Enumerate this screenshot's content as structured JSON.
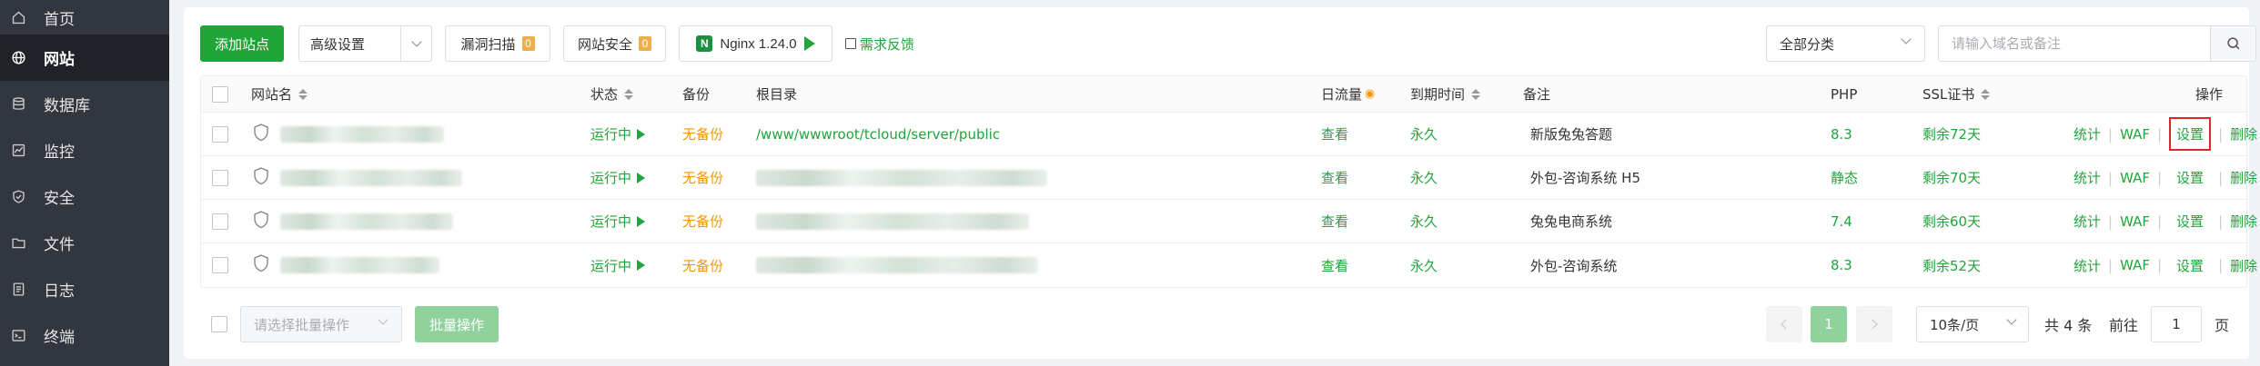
{
  "sidebar": {
    "items": [
      {
        "label": "首页",
        "icon": "home-icon"
      },
      {
        "label": "网站",
        "icon": "globe-icon",
        "active": true
      },
      {
        "label": "数据库",
        "icon": "database-icon"
      },
      {
        "label": "监控",
        "icon": "monitor-icon"
      },
      {
        "label": "安全",
        "icon": "shield-icon"
      },
      {
        "label": "文件",
        "icon": "folder-icon"
      },
      {
        "label": "日志",
        "icon": "log-icon"
      },
      {
        "label": "终端",
        "icon": "terminal-icon"
      }
    ]
  },
  "toolbar": {
    "add_site": "添加站点",
    "advanced": "高级设置",
    "vuln_scan": "漏洞扫描",
    "vuln_count": "0",
    "site_security": "网站安全",
    "security_count": "0",
    "nginx": "Nginx 1.24.0",
    "feedback": "需求反馈",
    "category": "全部分类",
    "search_placeholder": "请输入域名或备注"
  },
  "table": {
    "headers": {
      "name": "网站名",
      "status": "状态",
      "backup": "备份",
      "root": "根目录",
      "traffic": "日流量",
      "expire": "到期时间",
      "remark": "备注",
      "php": "PHP",
      "ssl": "SSL证书",
      "ops": "操作"
    },
    "rows": [
      {
        "status": "运行中",
        "backup": "无备份",
        "root": "/www/wwwroot/tcloud/server/public",
        "traffic": "查看",
        "expire": "永久",
        "remark": "新版兔兔答题",
        "php": "8.3",
        "ssl": "剩余72天"
      },
      {
        "status": "运行中",
        "backup": "无备份",
        "root": "",
        "traffic": "查看",
        "expire": "永久",
        "remark": "外包-咨询系统 H5",
        "php": "静态",
        "ssl": "剩余70天"
      },
      {
        "status": "运行中",
        "backup": "无备份",
        "root": "",
        "traffic": "查看",
        "expire": "永久",
        "remark": "兔兔电商系统",
        "php": "7.4",
        "ssl": "剩余60天"
      },
      {
        "status": "运行中",
        "backup": "无备份",
        "root": "",
        "traffic": "查看",
        "expire": "永久",
        "remark": "外包-咨询系统",
        "php": "8.3",
        "ssl": "剩余52天"
      }
    ],
    "ops": {
      "stats": "统计",
      "waf": "WAF",
      "settings": "设置",
      "delete": "删除"
    }
  },
  "footer": {
    "batch_placeholder": "请选择批量操作",
    "batch_button": "批量操作",
    "current_page": "1",
    "per_page": "10条/页",
    "total": "共 4 条",
    "goto": "前往",
    "goto_value": "1",
    "page_unit": "页"
  },
  "colors": {
    "accent": "#20a53a",
    "warning": "#f39800",
    "highlight": "#e0242b",
    "sidebar": "#32363e"
  }
}
